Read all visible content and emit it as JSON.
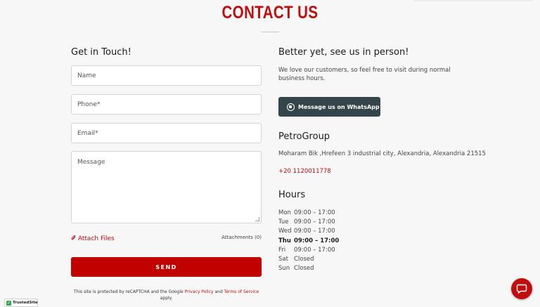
{
  "page": {
    "title": "CONTACT US"
  },
  "form": {
    "heading": "Get in Touch!",
    "name_placeholder": "Name",
    "phone_placeholder": "Phone*",
    "email_placeholder": "Email*",
    "message_placeholder": "Message",
    "attach_label": "Attach Files",
    "attachments_count": "Attachments (0)",
    "send_label": "SEND",
    "recaptcha": {
      "prefix": "This site is protected by reCAPTCHA and the Google",
      "privacy_label": "Privacy Policy",
      "and": "and",
      "terms_label": "Terms of Service",
      "suffix": "apply."
    }
  },
  "visit": {
    "heading": "Better yet, see us in person!",
    "intro": "We love our customers, so feel free to visit during normal business hours.",
    "whatsapp_label": "Message us on WhatsApp",
    "business_name": "PetroGroup",
    "address": "Moharam Bik ,Hrefeen 3 industrial city, Alexandria, Alexandria 21515",
    "phone": "+20 1120011778",
    "hours_heading": "Hours",
    "hours": [
      {
        "day": "Mon",
        "time": "09:00 – 17:00"
      },
      {
        "day": "Tue",
        "time": "09:00 – 17:00"
      },
      {
        "day": "Wed",
        "time": "09:00 – 17:00"
      },
      {
        "day": "Thu",
        "time": "09:00 – 17:00"
      },
      {
        "day": "Fri",
        "time": "09:00 – 17:00"
      },
      {
        "day": "Sat",
        "time": "Closed"
      },
      {
        "day": "Sun",
        "time": "Closed"
      }
    ],
    "highlighted_day": "Thu"
  },
  "badge": {
    "label": "TrustedSite"
  },
  "icons": {
    "attach": "paperclip-icon",
    "whatsapp": "whatsapp-icon",
    "chat": "chat-bubble-icon",
    "trusted": "check-icon"
  },
  "colors": {
    "accent": "#c10d0d",
    "send_button": "#c10000",
    "whatsapp_button": "#344649",
    "background": "#f7f7f7"
  }
}
